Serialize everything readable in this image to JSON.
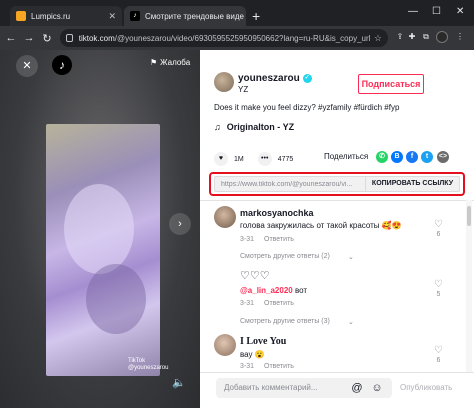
{
  "browser": {
    "tabs": [
      {
        "title": "Lumpics.ru",
        "active": false
      },
      {
        "title": "Смотрите трендовые виде",
        "active": true
      }
    ],
    "new_tab": "+",
    "url_host": "tiktok.com",
    "url_path": "/@youneszarou/video/6930595525950950662?lang=ru-RU&is_copy_url=1&"
  },
  "player": {
    "report_label": "Жалоба",
    "watermark_brand": "TikTok",
    "watermark_user": "@youneszarou"
  },
  "author": {
    "username": "youneszarou",
    "subtitle": "YZ",
    "follow_label": "Подписаться"
  },
  "video": {
    "caption": "Does it make you feel dizzy? #yzfamily #fürdich #fyp",
    "sound": "Originalton - YZ",
    "likes": "1M",
    "comments": "4775"
  },
  "share": {
    "label": "Поделиться",
    "copy_url": "https://www.tiktok.com/@youneszarou/vi...",
    "copy_button": "КОПИРОВАТЬ ССЫЛКУ"
  },
  "comments": [
    {
      "name": "markosyanochka",
      "text": "голова закружилась от такой красоты 🥰😍",
      "date": "3-31",
      "reply": "Ответить",
      "likes": "6",
      "more": "Смотреть другие ответы (2)"
    },
    {
      "name": "",
      "text": "♡♡♡",
      "mention": "@a_lin_a2020",
      "mention_suffix": "вот",
      "date": "3-31",
      "reply": "Ответить",
      "likes": "5",
      "more": "Смотреть другие ответы (3)"
    },
    {
      "name": "I Love You",
      "text": "вау 😮",
      "date": "3-31",
      "reply": "Ответить",
      "likes": "6"
    }
  ],
  "composer": {
    "placeholder": "Добавить комментарий...",
    "post_label": "Опубликовать"
  }
}
